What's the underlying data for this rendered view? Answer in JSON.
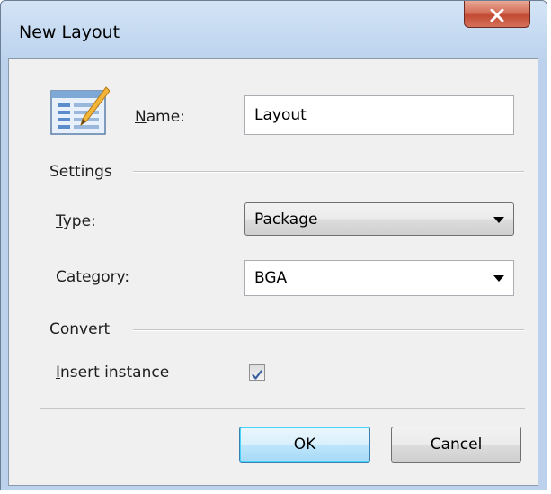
{
  "window": {
    "title": "New Layout",
    "close_label": "X"
  },
  "icons": {
    "app_icon": "layout-document-pencil-icon",
    "checkmark": "checkmark-icon",
    "dropdown_arrow": "chevron-down-icon"
  },
  "name_field": {
    "label_accel": "N",
    "label_rest": "ame:",
    "value": "Layout"
  },
  "settings": {
    "group_label": "Settings",
    "type": {
      "label_accel": "T",
      "label_rest": "ype:",
      "selected": "Package"
    },
    "category": {
      "label_accel": "C",
      "label_rest": "ategory:",
      "value": "BGA"
    }
  },
  "convert": {
    "group_label": "Convert",
    "insert_instance": {
      "label_accel": "I",
      "label_rest": "nsert instance",
      "checked": true
    }
  },
  "buttons": {
    "ok": "OK",
    "cancel": "Cancel"
  },
  "colors": {
    "title_bar": "#c4d9f1",
    "close_button": "#c24a33",
    "dialog_face": "#f0f0f0",
    "default_button_border": "#3c7fb1"
  }
}
